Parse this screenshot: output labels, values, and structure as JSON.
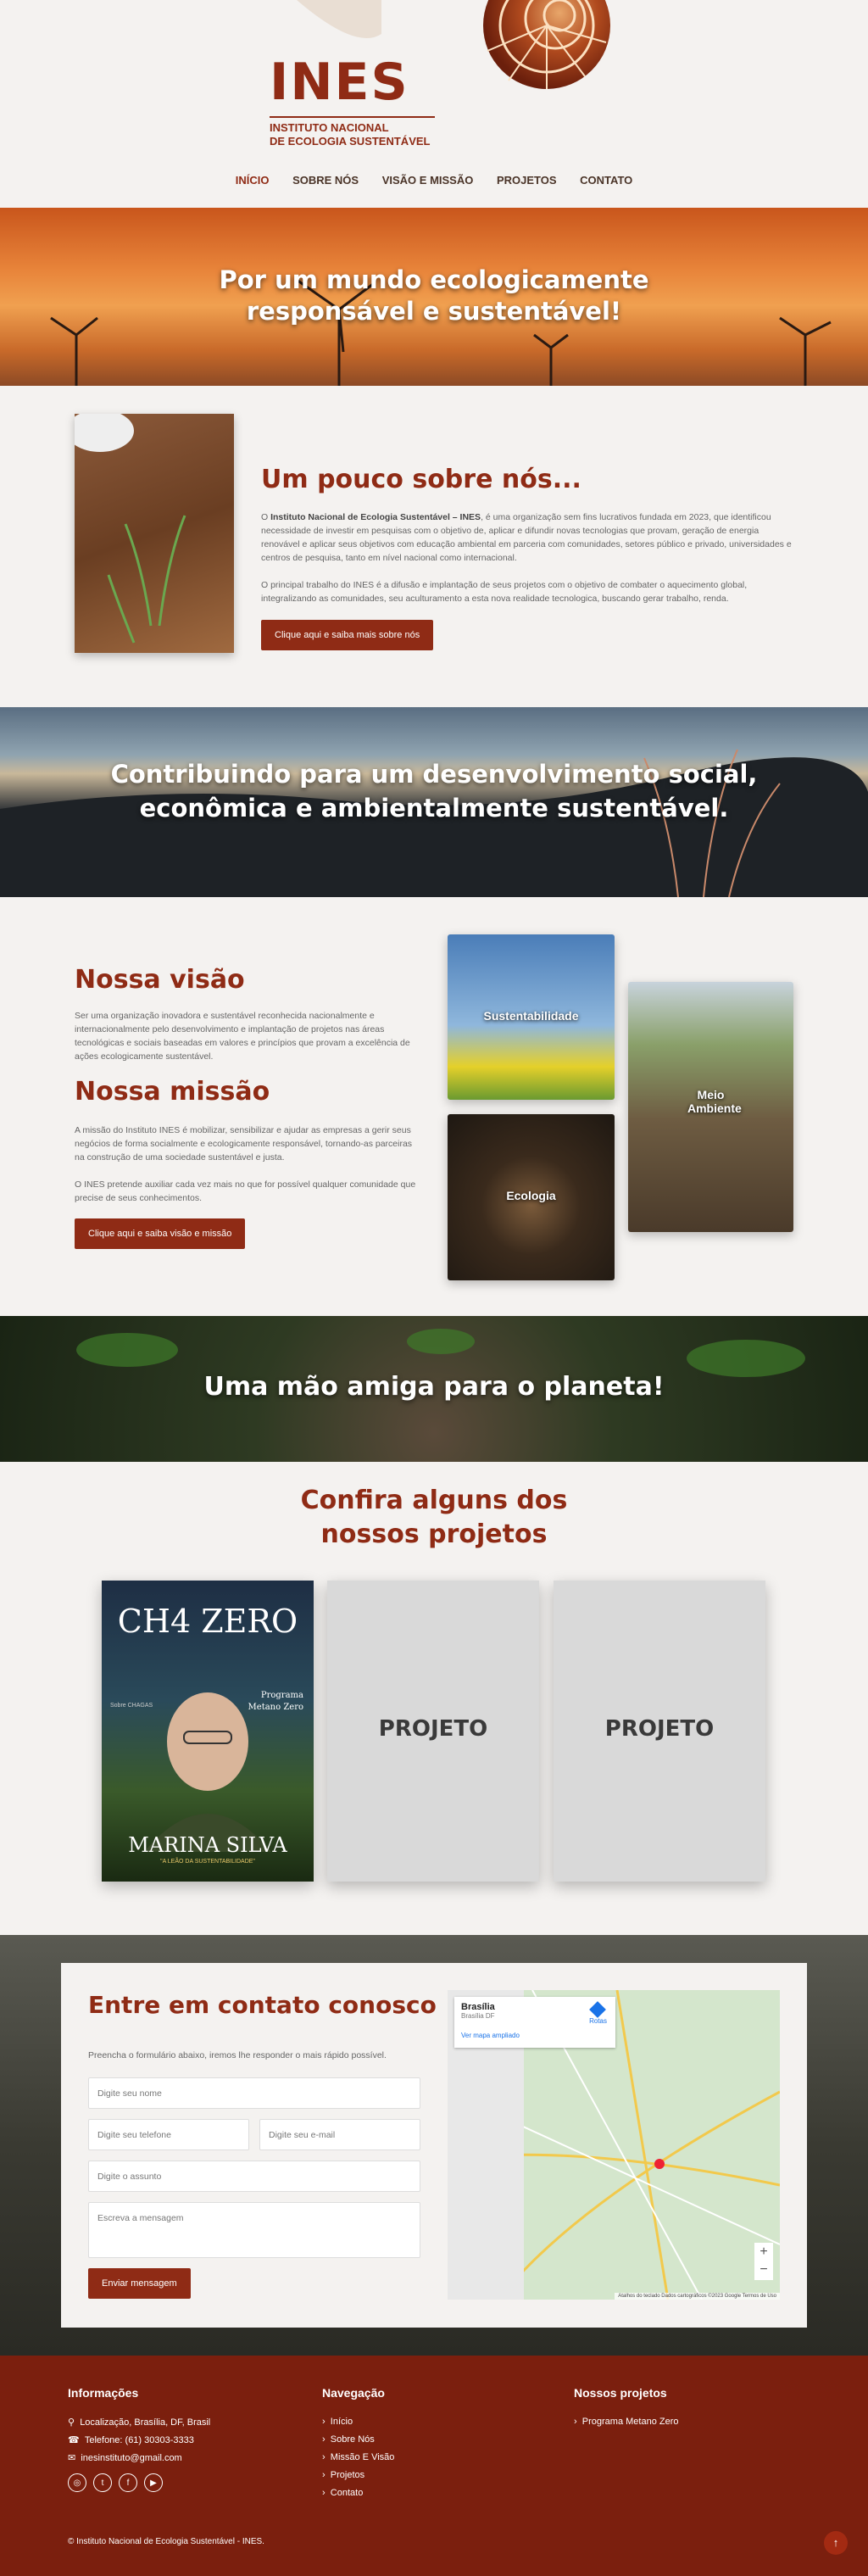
{
  "header": {
    "brand": "INES",
    "brand_sub1": "INSTITUTO NACIONAL",
    "brand_sub2": "DE ECOLOGIA SUSTENTÁVEL"
  },
  "nav": [
    "INÍCIO",
    "SOBRE NÓS",
    "VISÃO E MISSÃO",
    "PROJETOS",
    "CONTATO"
  ],
  "hero": {
    "line1": "Por um mundo ecologicamente",
    "line2": "responsável e sustentável!"
  },
  "about": {
    "title": "Um pouco sobre nós...",
    "p1_bold": "Instituto Nacional de Ecologia Sustentável – INES",
    "p1_pre": "O ",
    "p1": ", é uma organização sem fins lucrativos fundada em 2023, que identificou necessidade de investir em pesquisas com o objetivo de, aplicar e difundir novas tecnologias que provam, geração de energia renovável e aplicar seus objetivos com educação ambiental em parceria com comunidades, setores público e privado, universidades e centros de pesquisa, tanto em nível nacional como internacional.",
    "p2": "O principal trabalho do INES é a difusão e implantação de seus projetos com o objetivo de combater o aquecimento global, integralizando as comunidades, seu aculturamento a esta nova realidade tecnologica, buscando gerar trabalho, renda.",
    "button": "Clique aqui e saiba mais sobre nós"
  },
  "band2": {
    "line1": "Contribuindo para um desenvolvimento social,",
    "line2": "econômica e ambientalmente sustentável."
  },
  "vision": {
    "title": "Nossa visão",
    "text": "Ser uma organização inovadora e sustentável reconhecida nacionalmente e internacionalmente pelo desenvolvimento e implantação de projetos nas áreas tecnológicas e sociais baseadas em valores e princípios que provam a excelência de ações ecologicamente sustentável.",
    "mission_title": "Nossa missão",
    "m1": "A missão do Instituto INES é mobilizar, sensibilizar e ajudar as empresas a gerir seus negócios de forma socialmente e ecologicamente responsável, tornando-as parceiras na construção de uma sociedade sustentável e justa.",
    "m2": "O INES pretende auxiliar cada vez mais no que for possível qualquer comunidade que precise de seus conhecimentos.",
    "button": "Clique aqui e saiba visão e missão",
    "cards": [
      "Sustentabilidade",
      "Ecologia",
      "Meio Ambiente"
    ]
  },
  "band3": {
    "text": "Uma mão amiga para o planeta!"
  },
  "projects": {
    "title1": "Confira alguns dos",
    "title2": "nossos projetos",
    "p1_title": "CH4  ZERO",
    "p1_sub1": "Programa",
    "p1_sub2": "Metano Zero",
    "p1_name": "MARINA SILVA",
    "p1_tag": "\"A LEÃO DA SUSTENTABILIDADE\"",
    "p1_small": "Sobre CHAGAS",
    "placeholder": "PROJETO"
  },
  "contact": {
    "title": "Entre em contato conosco",
    "intro": "Preencha o formulário abaixo, iremos lhe responder o mais rápido possível.",
    "name": "Digite seu nome",
    "phone": "Digite seu telefone",
    "email": "Digite seu e-mail",
    "subject": "Digite o assunto",
    "message": "Escreva a mensagem",
    "button": "Enviar mensagem",
    "map_city": "Brasília",
    "map_state": "Brasília DF",
    "map_link": "Ver mapa ampliado",
    "map_routes": "Rotas",
    "map_footer": "Atalhos do teclado   Dados cartográficos ©2023 Google   Termos de Uso"
  },
  "footer": {
    "info_title": "Informações",
    "address": "Localização, Brasília, DF, Brasil",
    "phone": "Telefone: (61) 30303-3333",
    "email": "inesinstituto@gmail.com",
    "nav_title": "Navegação",
    "nav": [
      "Início",
      "Sobre Nós",
      "Missão E Visão",
      "Projetos",
      "Contato"
    ],
    "proj_title": "Nossos projetos",
    "proj": "Programa Metano Zero",
    "copy": "© Instituto Nacional de Ecologia Sustentável - INES."
  },
  "colors": {
    "accent": "#8f2b15",
    "footer": "#7b1f0e",
    "bg": "#f4f2f0"
  }
}
